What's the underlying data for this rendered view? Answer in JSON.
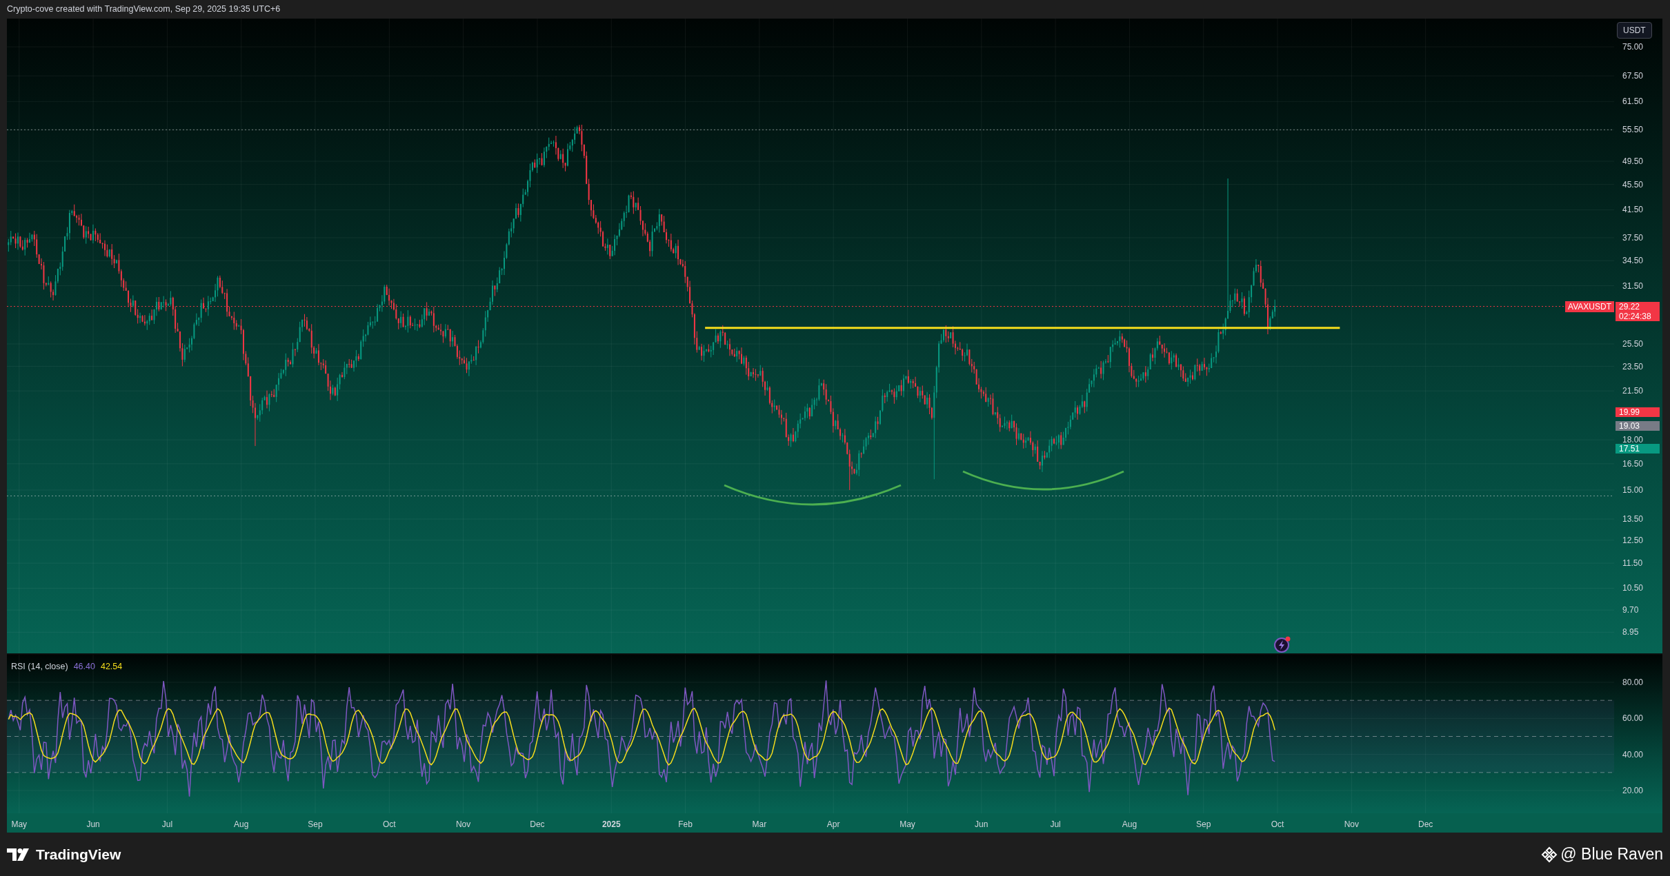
{
  "header": {
    "caption": "Crypto-cove created with TradingView.com, Sep 29, 2025 19:35 UTC+6"
  },
  "price_axis": {
    "currency": "USDT",
    "ticks": [
      "75.00",
      "67.50",
      "61.50",
      "55.50",
      "49.50",
      "45.50",
      "41.50",
      "37.50",
      "34.50",
      "31.50",
      "25.50",
      "23.50",
      "21.50",
      "18.00",
      "16.50",
      "15.00",
      "13.50",
      "12.50",
      "11.50",
      "10.50",
      "9.70",
      "8.95"
    ]
  },
  "symbol_tag": {
    "text": "AVAXUSDT"
  },
  "price_labels": [
    {
      "value": "29.22",
      "countdown": "02:24:38",
      "color": "#f23645"
    },
    {
      "value": "19.99",
      "color": "#f23645"
    },
    {
      "value": "19.03",
      "color": "#787b86"
    },
    {
      "value": "17.51",
      "color": "#089981"
    }
  ],
  "rsi": {
    "title": "RSI (14, close)",
    "rsi_value": "46.40",
    "ma_value": "42.54",
    "ticks": [
      "80.00",
      "60.00",
      "40.00",
      "20.00"
    ]
  },
  "time_axis": [
    {
      "label": "May",
      "kind": "month"
    },
    {
      "label": "Jun",
      "kind": "month"
    },
    {
      "label": "Jul",
      "kind": "month"
    },
    {
      "label": "Aug",
      "kind": "month"
    },
    {
      "label": "Sep",
      "kind": "month"
    },
    {
      "label": "Oct",
      "kind": "month"
    },
    {
      "label": "Nov",
      "kind": "month"
    },
    {
      "label": "Dec",
      "kind": "month"
    },
    {
      "label": "2025",
      "kind": "year"
    },
    {
      "label": "Feb",
      "kind": "month"
    },
    {
      "label": "Mar",
      "kind": "month"
    },
    {
      "label": "Apr",
      "kind": "month"
    },
    {
      "label": "May",
      "kind": "month"
    },
    {
      "label": "Jun",
      "kind": "month"
    },
    {
      "label": "Jul",
      "kind": "month"
    },
    {
      "label": "Aug",
      "kind": "month"
    },
    {
      "label": "Sep",
      "kind": "month"
    },
    {
      "label": "Oct",
      "kind": "month"
    },
    {
      "label": "Nov",
      "kind": "month"
    },
    {
      "label": "Dec",
      "kind": "month"
    }
  ],
  "footer": {
    "brand": "TradingView",
    "author": "@ Blue Raven"
  }
}
